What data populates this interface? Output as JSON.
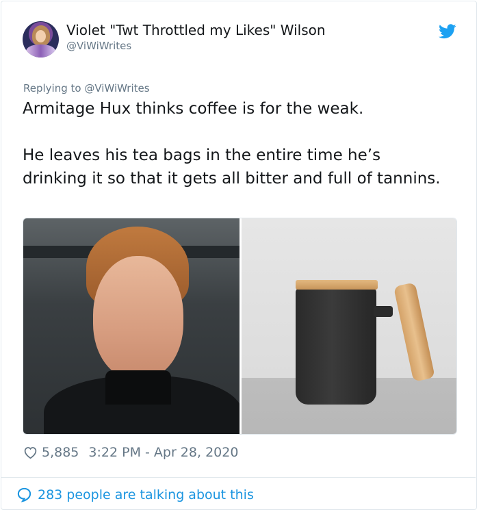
{
  "tweet": {
    "author_name": "Violet \"Twt Throttled my Likes\" Wilson",
    "author_handle": "@ViWiWrites",
    "replying_prefix": "Replying to",
    "replying_to": "@ViWiWrites",
    "text_paragraphs": [
      "Armitage Hux thinks coffee is for the weak.",
      "He leaves his tea bags in the entire time he’s drinking it so that it gets all bitter and full of tannins."
    ],
    "likes": "5,885",
    "timestamp": "3:22 PM - Apr 28, 2020",
    "conversation_text": "283 people are talking about this"
  },
  "icons": {
    "platform_logo": "twitter-bird-icon",
    "like": "heart-icon",
    "conversation": "speech-bubble-icon"
  },
  "colors": {
    "brand_blue": "#1da1f2",
    "link_blue": "#1b95e0",
    "secondary_text": "#657786",
    "primary_text": "#14171a",
    "border": "#e1e8ed"
  }
}
